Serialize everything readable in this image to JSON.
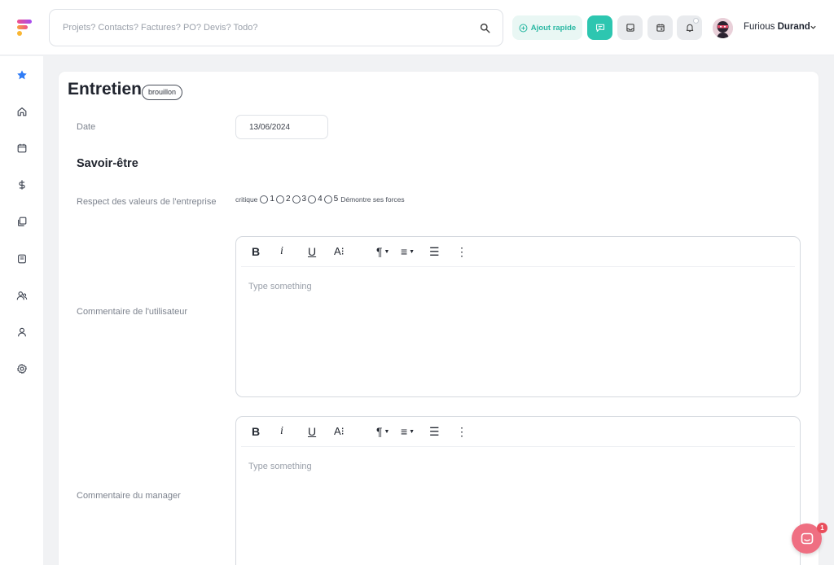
{
  "header": {
    "search_placeholder": "Projets? Contacts? Factures? PO? Devis? Todo?",
    "search_icon": "search-icon",
    "quick_add_label": "Ajout rapide",
    "quick_add_icon": "plus-circle-icon",
    "buttons": [
      {
        "icon": "message-icon",
        "active": true
      },
      {
        "icon": "inbox-icon",
        "active": false
      },
      {
        "icon": "calendar-icon",
        "active": false
      },
      {
        "icon": "bell-icon",
        "active": false
      }
    ],
    "user_first_name": "Furious",
    "user_last_name": "Durand",
    "accent_color": "#2dc6b0"
  },
  "sidebar": {
    "items": [
      {
        "icon": "star-icon",
        "active": true
      },
      {
        "icon": "home-icon"
      },
      {
        "icon": "calendar-icon"
      },
      {
        "icon": "dollar-icon"
      },
      {
        "icon": "documents-icon"
      },
      {
        "icon": "archive-icon"
      },
      {
        "icon": "users-icon"
      },
      {
        "icon": "user-icon"
      },
      {
        "icon": "settings-icon"
      }
    ]
  },
  "page": {
    "title": "Entretien",
    "status_badge": "brouillon",
    "date_label": "Date",
    "date_value": "13/06/2024",
    "section_title": "Savoir-être",
    "rating": {
      "label": "Respect des valeurs de l'entreprise",
      "low_label": "critique",
      "high_label": "Démontre ses forces",
      "options": [
        "1",
        "2",
        "3",
        "4",
        "5"
      ]
    },
    "user_comment_label": "Commentaire de l'utilisateur",
    "manager_comment_label": "Commentaire du manager",
    "editor_placeholder": "Type something",
    "toolbar": {
      "bold": "B",
      "italic": "i",
      "underline": "U",
      "font_size": "A⁝",
      "paragraph": "¶",
      "align": "≡",
      "list": "☰",
      "more": "⋮"
    }
  },
  "chat": {
    "icon": "chat-icon",
    "unread_count": "1"
  }
}
